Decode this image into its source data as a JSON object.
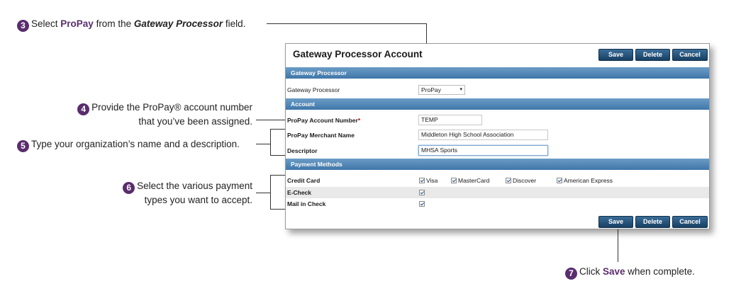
{
  "annotations": {
    "step3": {
      "number": "3",
      "prefix": "Select ",
      "highlight": "ProPay",
      "middle": " from the ",
      "field": "Gateway Processor",
      "suffix": " field."
    },
    "step4": {
      "number": "4",
      "line1": "Provide the ProPay® account number",
      "line2": "that you’ve been assigned."
    },
    "step5": {
      "number": "5",
      "text": "Type your organization’s name and a description."
    },
    "step6": {
      "number": "6",
      "line1": "Select the various payment",
      "line2": "types you want to accept."
    },
    "step7": {
      "number": "7",
      "prefix": "Click ",
      "highlight": "Save",
      "suffix": " when complete."
    }
  },
  "panel": {
    "title": "Gateway Processor Account",
    "buttons": {
      "save": "Save",
      "delete": "Delete",
      "cancel": "Cancel"
    },
    "sections": {
      "gateway": "Gateway Processor",
      "account": "Account",
      "payment": "Payment Methods"
    },
    "gateway_processor": {
      "label": "Gateway Processor",
      "value": "ProPay"
    },
    "account": {
      "number_label": "ProPay Account Number",
      "required_mark": "*",
      "number_value": "TEMP",
      "merchant_label": "ProPay Merchant Name",
      "merchant_value": "Middleton High School Association",
      "descriptor_label": "Descriptor",
      "descriptor_value": "MHSA Sports"
    },
    "payment": {
      "credit_label": "Credit Card",
      "cards": [
        "Visa",
        "MasterCard",
        "Discover",
        "American Express"
      ],
      "echeck_label": "E-Check",
      "mail_label": "Mail in Check"
    }
  },
  "colors": {
    "accent": "#5a2d6e",
    "section_bar": "#4f85b5",
    "button": "#1f4a72"
  }
}
